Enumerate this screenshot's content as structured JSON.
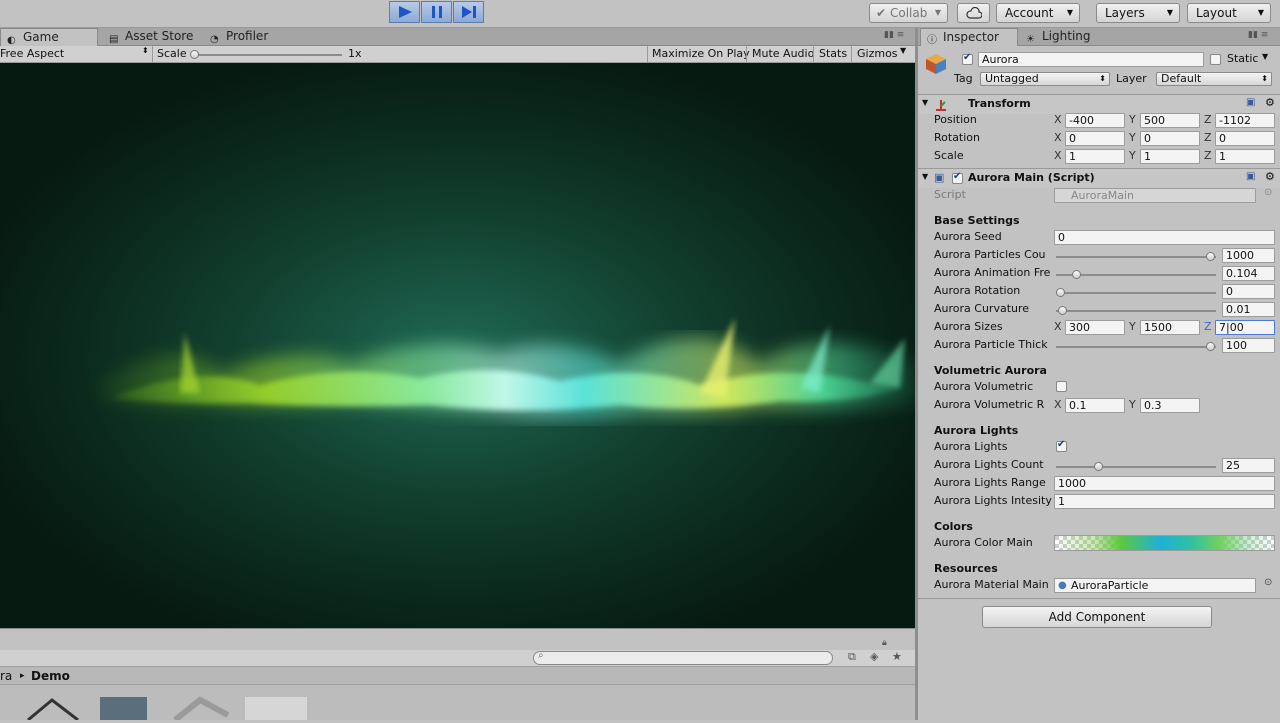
{
  "toolbar": {
    "collab": "Collab",
    "account": "Account",
    "layers": "Layers",
    "layout": "Layout"
  },
  "tabs": {
    "game": "Game",
    "asset_store": "Asset Store",
    "profiler": "Profiler",
    "inspector": "Inspector",
    "lighting": "Lighting"
  },
  "game_controls": {
    "aspect": "Free Aspect",
    "scale_label": "Scale",
    "scale_value": "1x",
    "maximize": "Maximize On Play",
    "mute": "Mute Audio",
    "stats": "Stats",
    "gizmos": "Gizmos"
  },
  "project": {
    "breadcrumb_prev": "ra",
    "breadcrumb_current": "Demo"
  },
  "inspector": {
    "object_name": "Aurora",
    "static_label": "Static",
    "tag_label": "Tag",
    "tag_value": "Untagged",
    "layer_label": "Layer",
    "layer_value": "Default",
    "transform": {
      "title": "Transform",
      "position_label": "Position",
      "rotation_label": "Rotation",
      "scale_label": "Scale",
      "position": {
        "x": "-400",
        "y": "500",
        "z": "-1102"
      },
      "rotation": {
        "x": "0",
        "y": "0",
        "z": "0"
      },
      "scale": {
        "x": "1",
        "y": "1",
        "z": "1"
      }
    },
    "script": {
      "title": "Aurora Main (Script)",
      "script_label": "Script",
      "script_value": "AuroraMain",
      "base_header": "Base Settings",
      "seed_label": "Aurora Seed",
      "seed_value": "0",
      "particles_label": "Aurora Particles Cou",
      "particles_value": "1000",
      "particles_level": 1.0,
      "anim_label": "Aurora Animation Fre",
      "anim_value": "0.104",
      "anim_level": 0.104,
      "rotation_label": "Aurora Rotation",
      "rotation_value": "0",
      "rotation_level": 0,
      "curvature_label": "Aurora Curvature",
      "curvature_value": "0.01",
      "curvature_level": 0.01,
      "sizes_label": "Aurora Sizes",
      "sizes": {
        "x": "300",
        "y": "1500",
        "z": "7|00"
      },
      "thick_label": "Aurora Particle Thick",
      "thick_value": "100",
      "thick_level": 1.0,
      "vol_header": "Volumetric Aurora",
      "vol_label": "Aurora Volumetric",
      "vol_r_label": "Aurora Volumetric R",
      "vol_r": {
        "x": "0.1",
        "y": "0.3"
      },
      "lights_header": "Aurora Lights",
      "lights_label": "Aurora Lights",
      "lights_count_label": "Aurora Lights Count",
      "lights_count_value": "25",
      "lights_count_level": 0.25,
      "lights_range_label": "Aurora Lights Range",
      "lights_range_value": "1000",
      "lights_intensity_label": "Aurora Lights Intesity",
      "lights_intensity_value": "1",
      "colors_header": "Colors",
      "color_main_label": "Aurora Color Main",
      "resources_header": "Resources",
      "material_label": "Aurora Material Main",
      "material_value": "AuroraParticle"
    },
    "add_component": "Add Component"
  }
}
